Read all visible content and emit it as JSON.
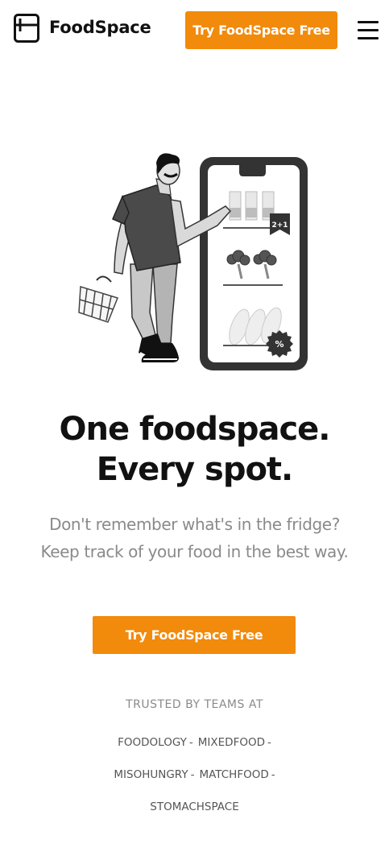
{
  "header": {
    "brand_name": "FoodSpace",
    "cta_label": "Try FoodSpace Free",
    "logo_icon": "fridge-icon",
    "menu_icon": "hamburger-menu-icon"
  },
  "hero": {
    "title_line1": "One foodspace.",
    "title_line2": "Every spot.",
    "subtitle": "Don't remember what's in the fridge? Keep track of your food in the best way.",
    "cta_label": "Try FoodSpace Free",
    "illustration": {
      "icon": "shopper-with-phone-illustration",
      "badge_text": "2+1"
    }
  },
  "trusted": {
    "heading": "TRUSTED BY TEAMS AT",
    "brands": [
      {
        "name": "FOODOLOGY",
        "sep": "-"
      },
      {
        "name": "MIXEDFOOD",
        "sep": "-"
      },
      {
        "name": "MISOHUNGRY",
        "sep": "-"
      },
      {
        "name": "MATCHFOOD",
        "sep": "-"
      },
      {
        "name": "STOMACHSPACE",
        "sep": ""
      }
    ]
  },
  "colors": {
    "accent": "#f28a0b",
    "text": "#111111",
    "muted": "#8a8a8a"
  }
}
